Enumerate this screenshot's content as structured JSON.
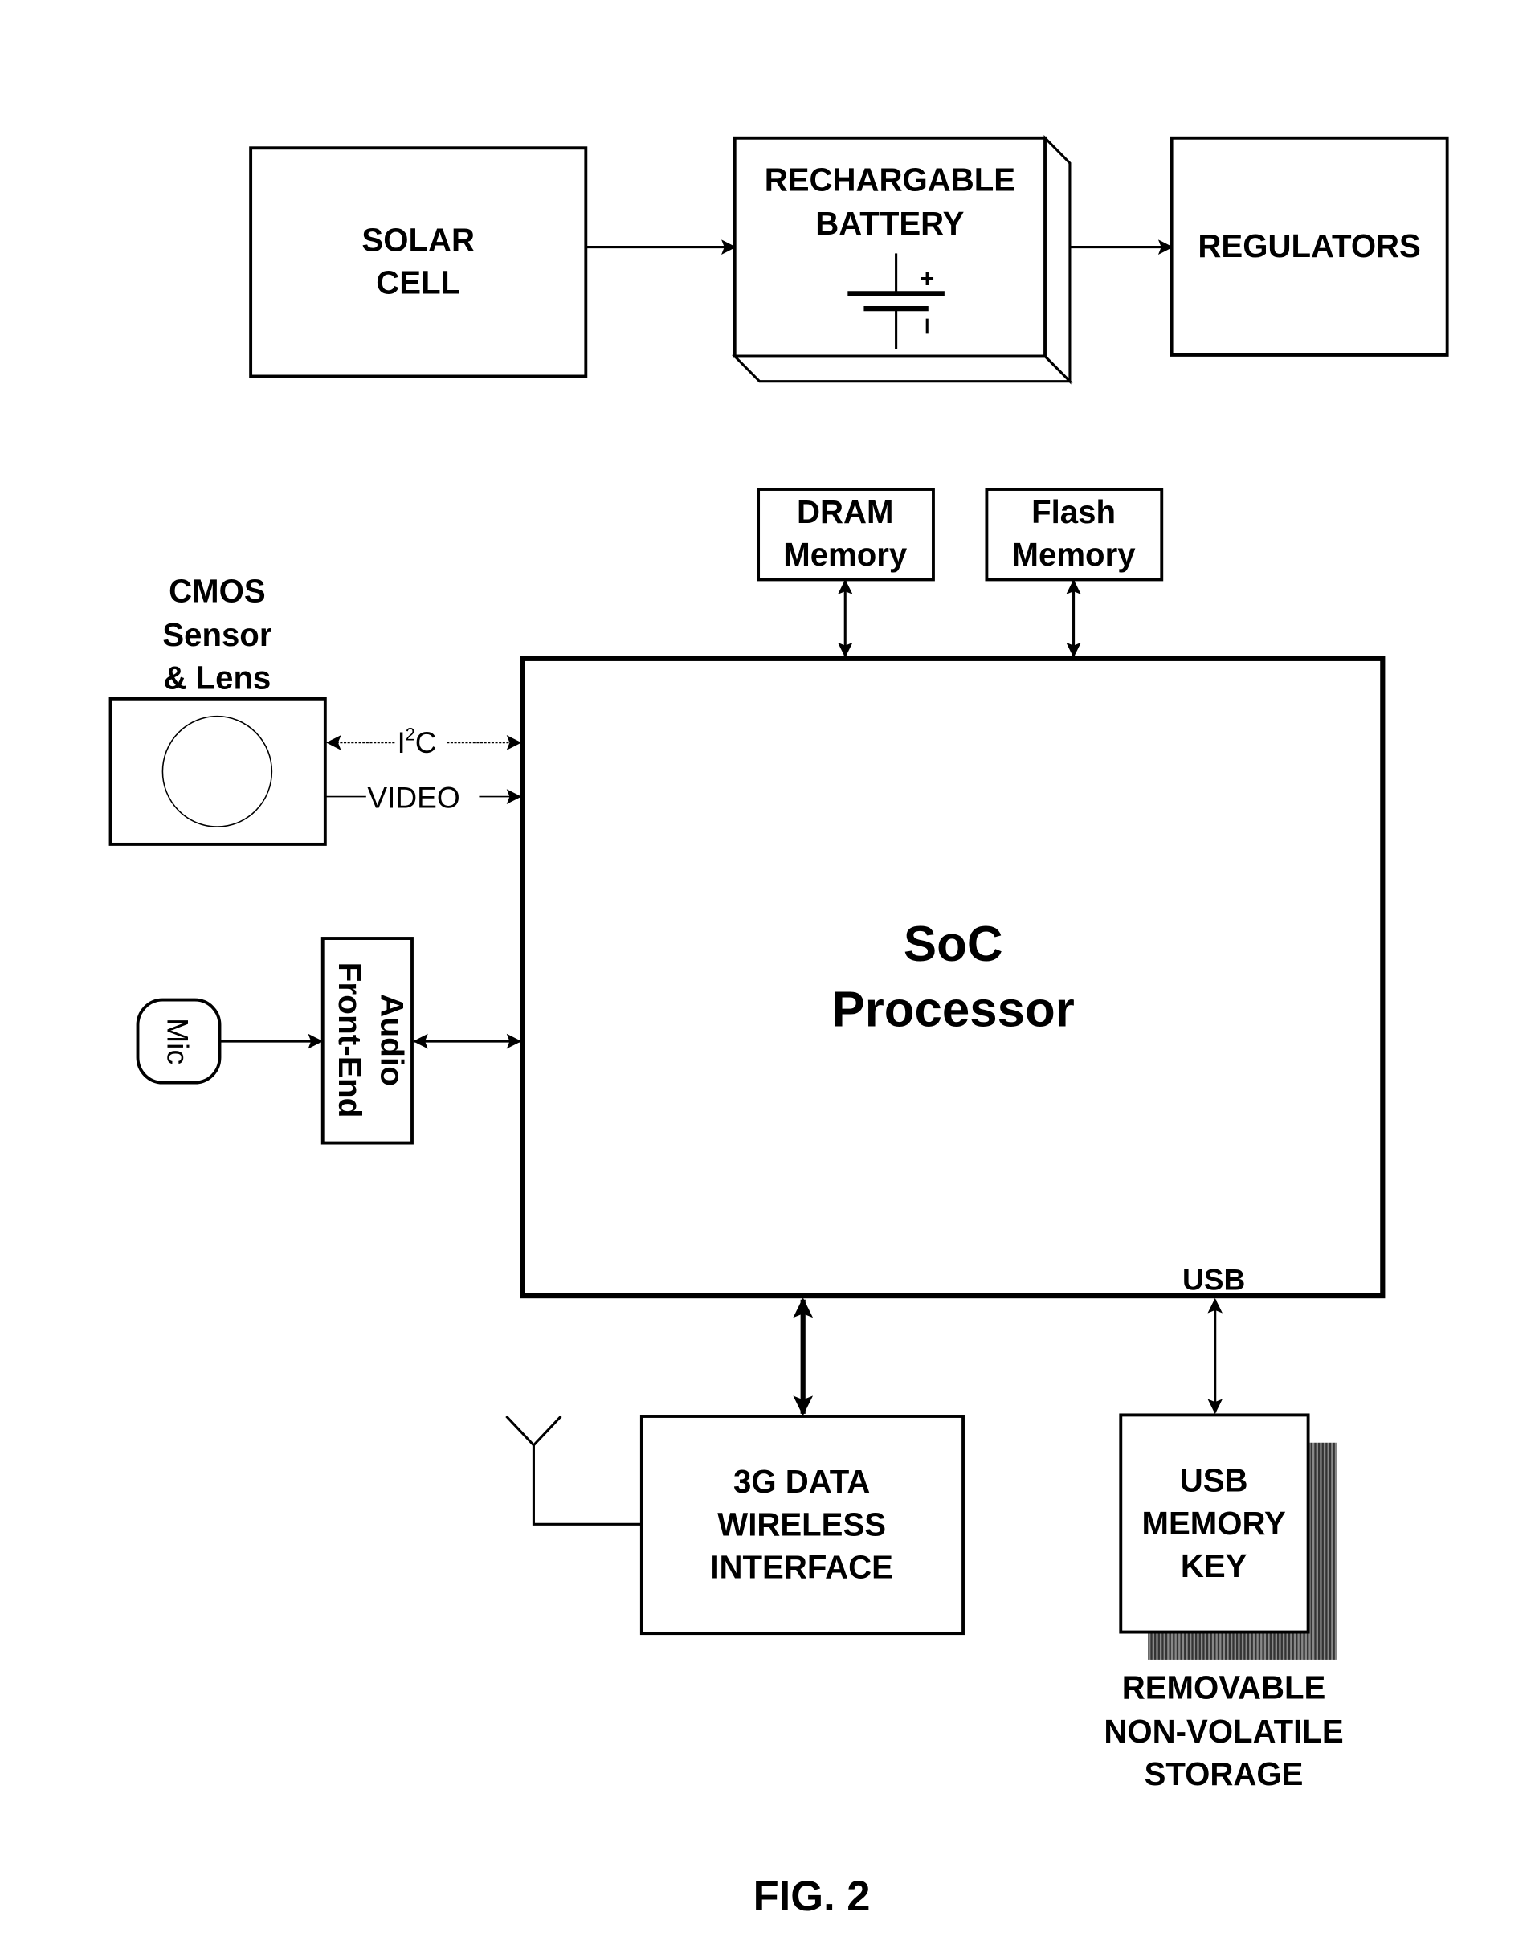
{
  "power_chain": {
    "solar_cell": [
      "SOLAR",
      "CELL"
    ],
    "battery": [
      "RECHARGABLE",
      "BATTERY"
    ],
    "battery_plus": "+",
    "battery_minus": "-",
    "regulators": "REGULATORS"
  },
  "memory": {
    "dram": [
      "DRAM",
      "Memory"
    ],
    "flash": [
      "Flash",
      "Memory"
    ]
  },
  "camera": {
    "title": [
      "CMOS",
      "Sensor",
      "& Lens"
    ],
    "i2c_label": "I",
    "i2c_sup": "2",
    "i2c_suffix": "C",
    "video_label": "VIDEO"
  },
  "audio": {
    "mic": "Mic",
    "front_end": [
      "Audio",
      "Front-End"
    ]
  },
  "soc": {
    "title": [
      "SoC",
      "Processor"
    ],
    "usb_port": "USB"
  },
  "wireless": [
    "3G DATA",
    "WIRELESS",
    "INTERFACE"
  ],
  "usb_key": {
    "label": [
      "USB",
      "MEMORY",
      "KEY"
    ],
    "caption": [
      "REMOVABLE",
      "NON-VOLATILE",
      "STORAGE"
    ]
  },
  "figure_label": "FIG. 2",
  "colors": {
    "ink": "#000000",
    "paper": "#ffffff",
    "shadow": "#555555"
  }
}
